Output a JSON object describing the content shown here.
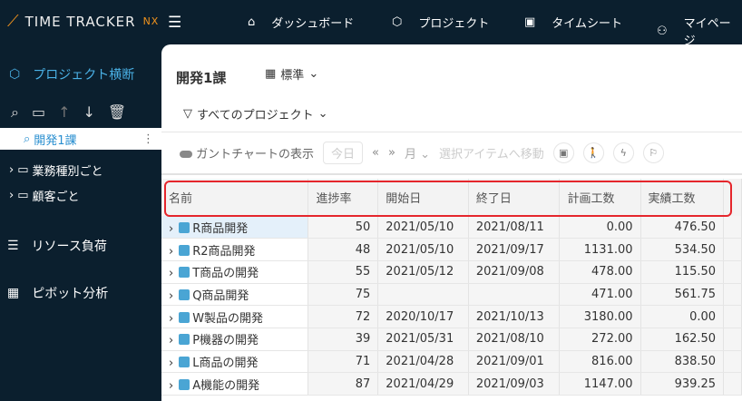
{
  "header": {
    "logo": "TIME TRACKER",
    "logo_suffix": "NX",
    "nav": [
      {
        "label": "ダッシュボード",
        "icon": "home-icon"
      },
      {
        "label": "プロジェクト",
        "icon": "cube-icon"
      },
      {
        "label": "タイムシート",
        "icon": "calendar-icon"
      },
      {
        "label": "マイページ",
        "icon": "user-icon"
      }
    ]
  },
  "sidebar": {
    "title": "プロジェクト横断",
    "selected": "開発1課",
    "tree": [
      "業務種別ごと",
      "顧客ごと"
    ],
    "sections": [
      "リソース負荷",
      "ピボット分析"
    ]
  },
  "main": {
    "title": "開発1課",
    "view": "標準",
    "filter": "すべてのプロジェクト",
    "toolbar": {
      "gantt": "ガントチャートの表示",
      "today": "今日",
      "unit": "月",
      "goto": "選択アイテムへ移動"
    }
  },
  "table": {
    "columns": [
      "名前",
      "進捗率",
      "開始日",
      "終了日",
      "計画工数",
      "実績工数"
    ],
    "rows": [
      [
        "R商品開発",
        "50",
        "2021/05/10",
        "2021/08/11",
        "0.00",
        "476.50"
      ],
      [
        "R2商品開発",
        "48",
        "2021/05/10",
        "2021/09/17",
        "1131.00",
        "534.50"
      ],
      [
        "T商品の開発",
        "55",
        "2021/05/12",
        "2021/09/08",
        "478.00",
        "115.50"
      ],
      [
        "Q商品開発",
        "75",
        "",
        "",
        "471.00",
        "561.75"
      ],
      [
        "W製品の開発",
        "72",
        "2020/10/17",
        "2021/10/13",
        "3180.00",
        "0.00"
      ],
      [
        "P機器の開発",
        "39",
        "2021/05/31",
        "2021/08/10",
        "272.00",
        "162.50"
      ],
      [
        "L商品の開発",
        "71",
        "2021/04/28",
        "2021/09/01",
        "816.00",
        "838.50"
      ],
      [
        "A機能の開発",
        "87",
        "2021/04/29",
        "2021/09/03",
        "1147.00",
        "939.25"
      ]
    ]
  },
  "colors": {
    "topbar": "#0b1f2e",
    "accent": "#4ab1e6",
    "logo_accent": "#f0921d",
    "highlight": "#e5262c"
  }
}
